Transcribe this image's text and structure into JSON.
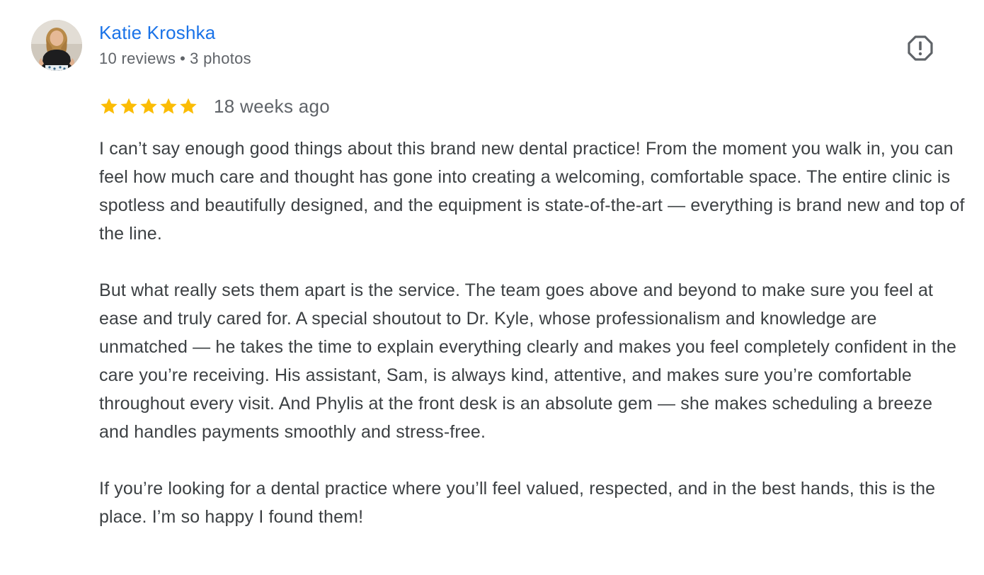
{
  "review": {
    "author": {
      "name": "Katie Kroshka",
      "review_count": "10 reviews",
      "separator": "•",
      "photo_count": "3 photos"
    },
    "rating": {
      "stars": 5,
      "max_stars": 5,
      "star_color": "#fbbc04"
    },
    "date": "18 weeks ago",
    "paragraphs": [
      "I can’t say enough good things about this brand new dental practice! From the moment you walk in, you can feel how much care and thought has gone into creating a welcoming, comfortable space. The entire clinic is spotless and beautifully designed, and the equipment is state-of-the-art — everything is brand new and top of the line.",
      "But what really sets them apart is the service. The team goes above and beyond to make sure you feel at ease and truly cared for. A special shoutout to Dr. Kyle, whose professionalism and knowledge are unmatched — he takes the time to explain everything clearly and makes you feel completely confident in the care you’re receiving. His assistant, Sam, is always kind, attentive, and makes sure you’re comfortable throughout every visit. And Phylis at the front desk is an absolute gem — she makes scheduling a breeze and handles payments smoothly and stress-free.",
      "If you’re looking for a dental practice where you’ll feel valued, respected, and in the best hands, this is the place. I’m so happy I found them!"
    ],
    "report_icon": "report-flag-icon"
  },
  "colors": {
    "author_link": "#1a73e8",
    "meta_text": "#5f6368",
    "body_text": "#3c4043",
    "icon": "#5f6368"
  }
}
